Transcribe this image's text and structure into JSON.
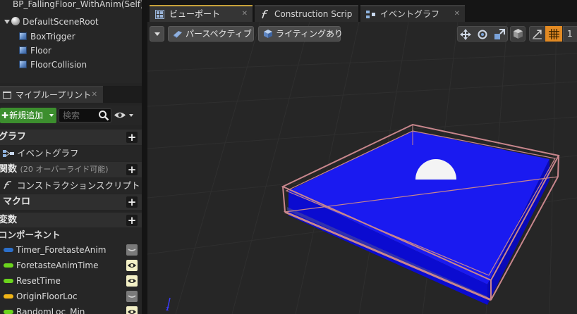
{
  "hierarchy": {
    "root_label": "BP_FallingFloor_WithAnim(Self)",
    "scene_root": "DefaultSceneRoot",
    "children": [
      "BoxTrigger",
      "Floor",
      "FloorCollision"
    ]
  },
  "my_blueprint": {
    "tab_label": "マイブループリント",
    "add_new_label": "新規追加",
    "search_placeholder": "検索",
    "sections": {
      "graph": {
        "label": "グラフ",
        "items": [
          "イベントグラフ"
        ]
      },
      "functions": {
        "label": "関数",
        "note": "(20 オーバーライド可能)",
        "items": [
          "コンストラクションスクリプト"
        ]
      },
      "macros": {
        "label": "マクロ"
      },
      "variables": {
        "label": "変数",
        "sub": "コンポーネント"
      }
    },
    "variables": [
      {
        "name": "Timer_ForetasteAnim",
        "color": "#2c6fc9",
        "visible": false
      },
      {
        "name": "ForetasteAnimTime",
        "color": "#6bd41d",
        "visible": true
      },
      {
        "name": "ResetTime",
        "color": "#6bd41d",
        "visible": true
      },
      {
        "name": "OriginFloorLoc",
        "color": "#f0b417",
        "visible": false
      },
      {
        "name": "RandomLoc_Min",
        "color": "#6bd41d",
        "visible": true
      }
    ]
  },
  "editor_tabs": [
    {
      "label": "ビューポート",
      "icon": "viewport-icon",
      "active": true
    },
    {
      "label": "Construction Scrip",
      "icon": "function-icon",
      "active": false
    },
    {
      "label": "イベントグラフ",
      "icon": "graph-icon",
      "active": false
    }
  ],
  "viewport": {
    "perspective_label": "パースペクティブ",
    "lighting_label": "ライティングあり",
    "colors": {
      "floor_top": "#1a1af0",
      "floor_side": "#0b0bd0",
      "collision_outline": "#c8868c",
      "background": "#262626"
    }
  }
}
